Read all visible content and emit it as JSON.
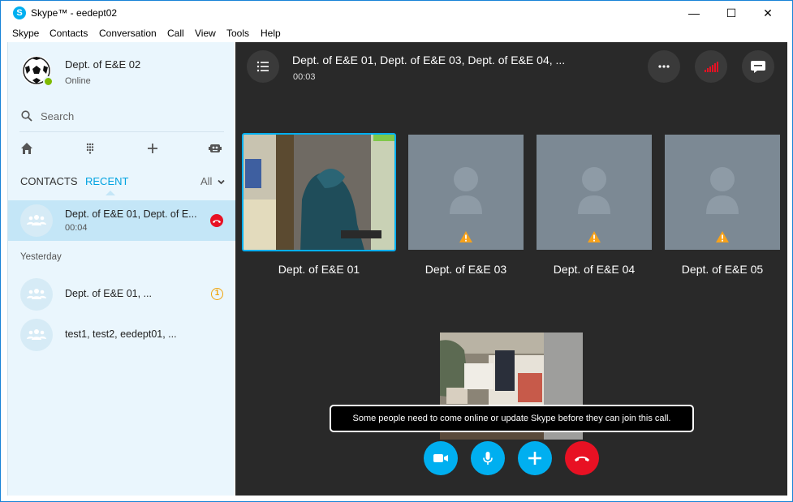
{
  "window": {
    "title": "Skype™ - eedept02",
    "app_icon_glyph": "S",
    "controls": {
      "minimize": "—",
      "maximize": "☐",
      "close": "✕"
    }
  },
  "menu": [
    "Skype",
    "Contacts",
    "Conversation",
    "Call",
    "View",
    "Tools",
    "Help"
  ],
  "profile": {
    "name": "Dept. of E&E 02",
    "status": "Online"
  },
  "search": {
    "placeholder": "Search"
  },
  "nav_icons": [
    "home-icon",
    "dialpad-icon",
    "add-icon",
    "bot-icon"
  ],
  "tabs": {
    "contacts": "CONTACTS",
    "recent": "RECENT",
    "all": "All"
  },
  "conversations": {
    "active": {
      "title": "Dept. of E&E 01, Dept. of E...",
      "subtitle": "00:04"
    },
    "section_label": "Yesterday",
    "items": [
      {
        "title": "Dept. of E&E 01, ...",
        "badge": "1"
      },
      {
        "title": "test1, test2, eedept01, ..."
      }
    ]
  },
  "call": {
    "title": "Dept. of E&E 01, Dept. of E&E 03, Dept. of E&E 04, ...",
    "timer": "00:03",
    "participants": [
      {
        "name": "Dept. of E&E 01",
        "video": true
      },
      {
        "name": "Dept. of E&E 03",
        "video": false,
        "warning": true
      },
      {
        "name": "Dept. of E&E 04",
        "video": false,
        "warning": true
      },
      {
        "name": "Dept. of E&E 05",
        "video": false,
        "warning": true
      }
    ],
    "toast": "Some people need to come online or update Skype before they can join this call.",
    "controls": [
      "video-button",
      "mic-button",
      "add-participant-button",
      "end-call-button"
    ]
  },
  "colors": {
    "accent": "#00aff0",
    "end_call": "#e81123",
    "presence": "#7fba00",
    "warning": "#f0a30a",
    "sidebar_bg": "#eaf6fd",
    "call_bg": "#292929"
  }
}
